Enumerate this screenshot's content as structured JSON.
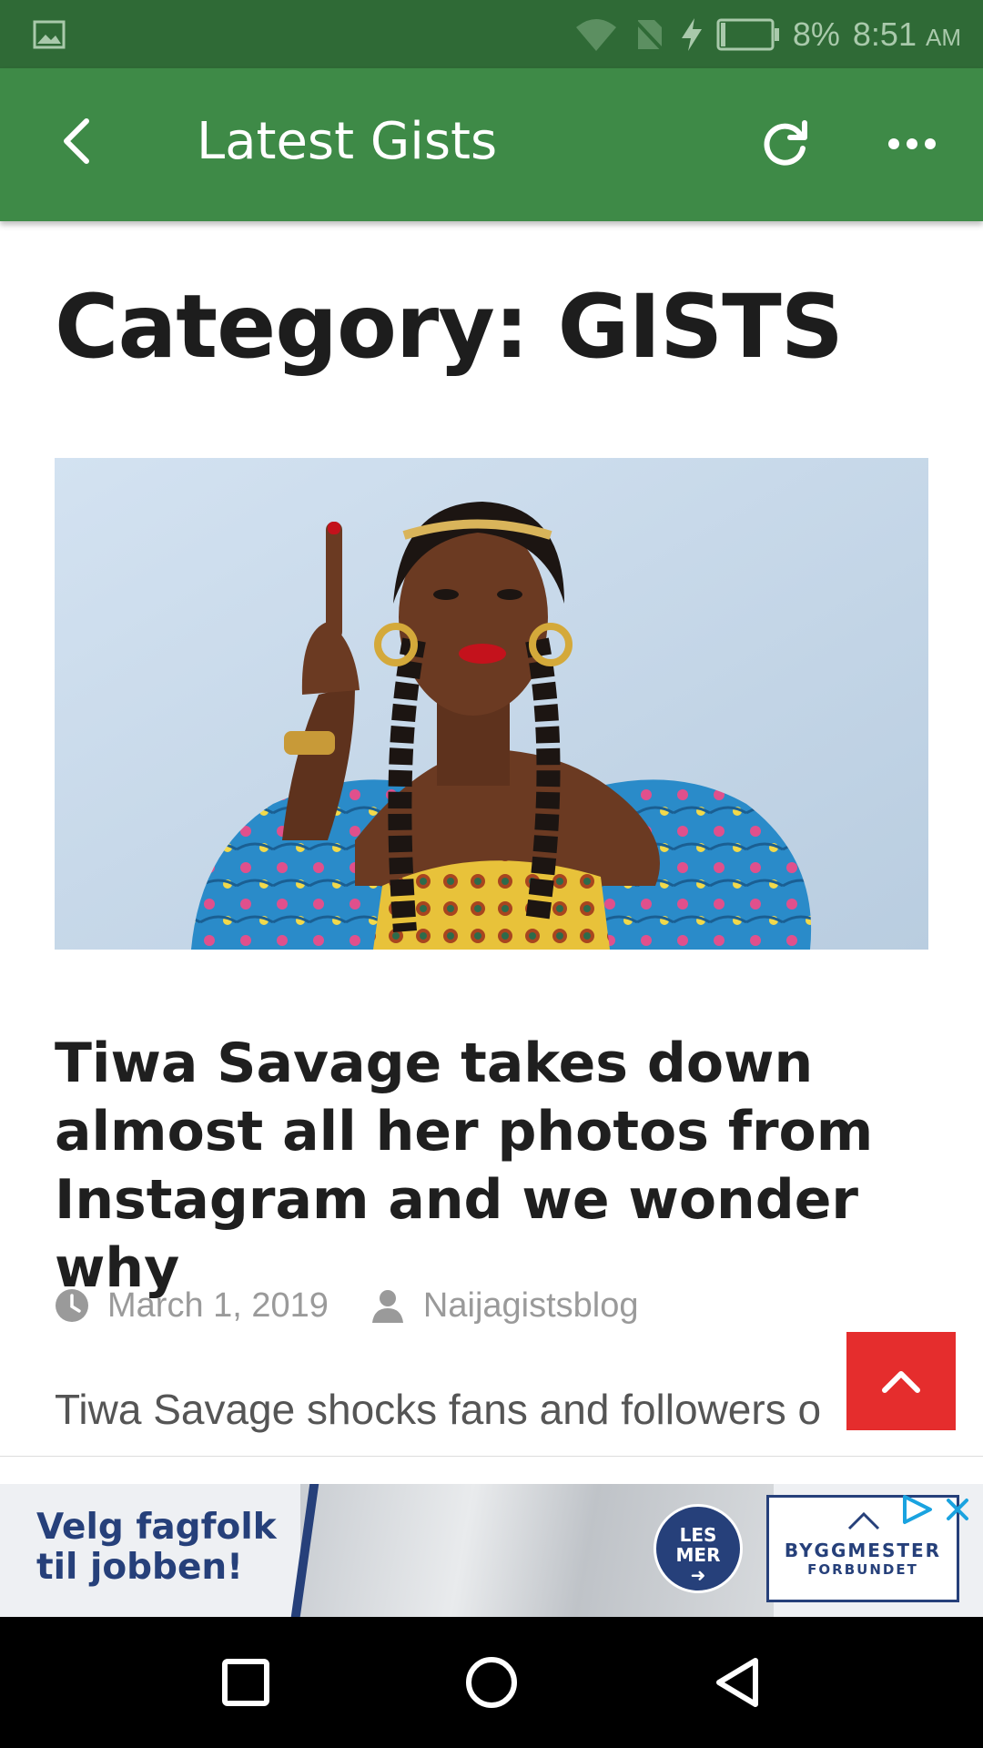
{
  "status_bar": {
    "battery_percent": "8%",
    "time": "8:51",
    "ampm": "AM",
    "icons": [
      "gallery-icon",
      "wifi-icon",
      "no-sim-icon",
      "charging-icon",
      "battery-icon"
    ]
  },
  "app_bar": {
    "title": "Latest Gists",
    "icons": [
      "back-arrow-icon",
      "refresh-icon",
      "more-options-icon"
    ]
  },
  "page": {
    "category_title": "Category: GISTS",
    "post": {
      "title": "Tiwa Savage takes down almost all her photos from Instagram and we wonder why",
      "date": "March 1, 2019",
      "author": "Naijagistsblog",
      "excerpt": "Tiwa Savage shocks fans and followers o"
    }
  },
  "ad": {
    "headline_line1": "Velg fagfolk",
    "headline_line2": "til jobben!",
    "cta_line1": "LES",
    "cta_line2": "MER",
    "brand_line1": "BYGGMESTER",
    "brand_line2": "FORBUNDET"
  },
  "colors": {
    "status_bar": "#2f6a36",
    "app_bar": "#3e8a47",
    "scroll_top_button": "#e52d2d",
    "ad_blue": "#26407a"
  }
}
